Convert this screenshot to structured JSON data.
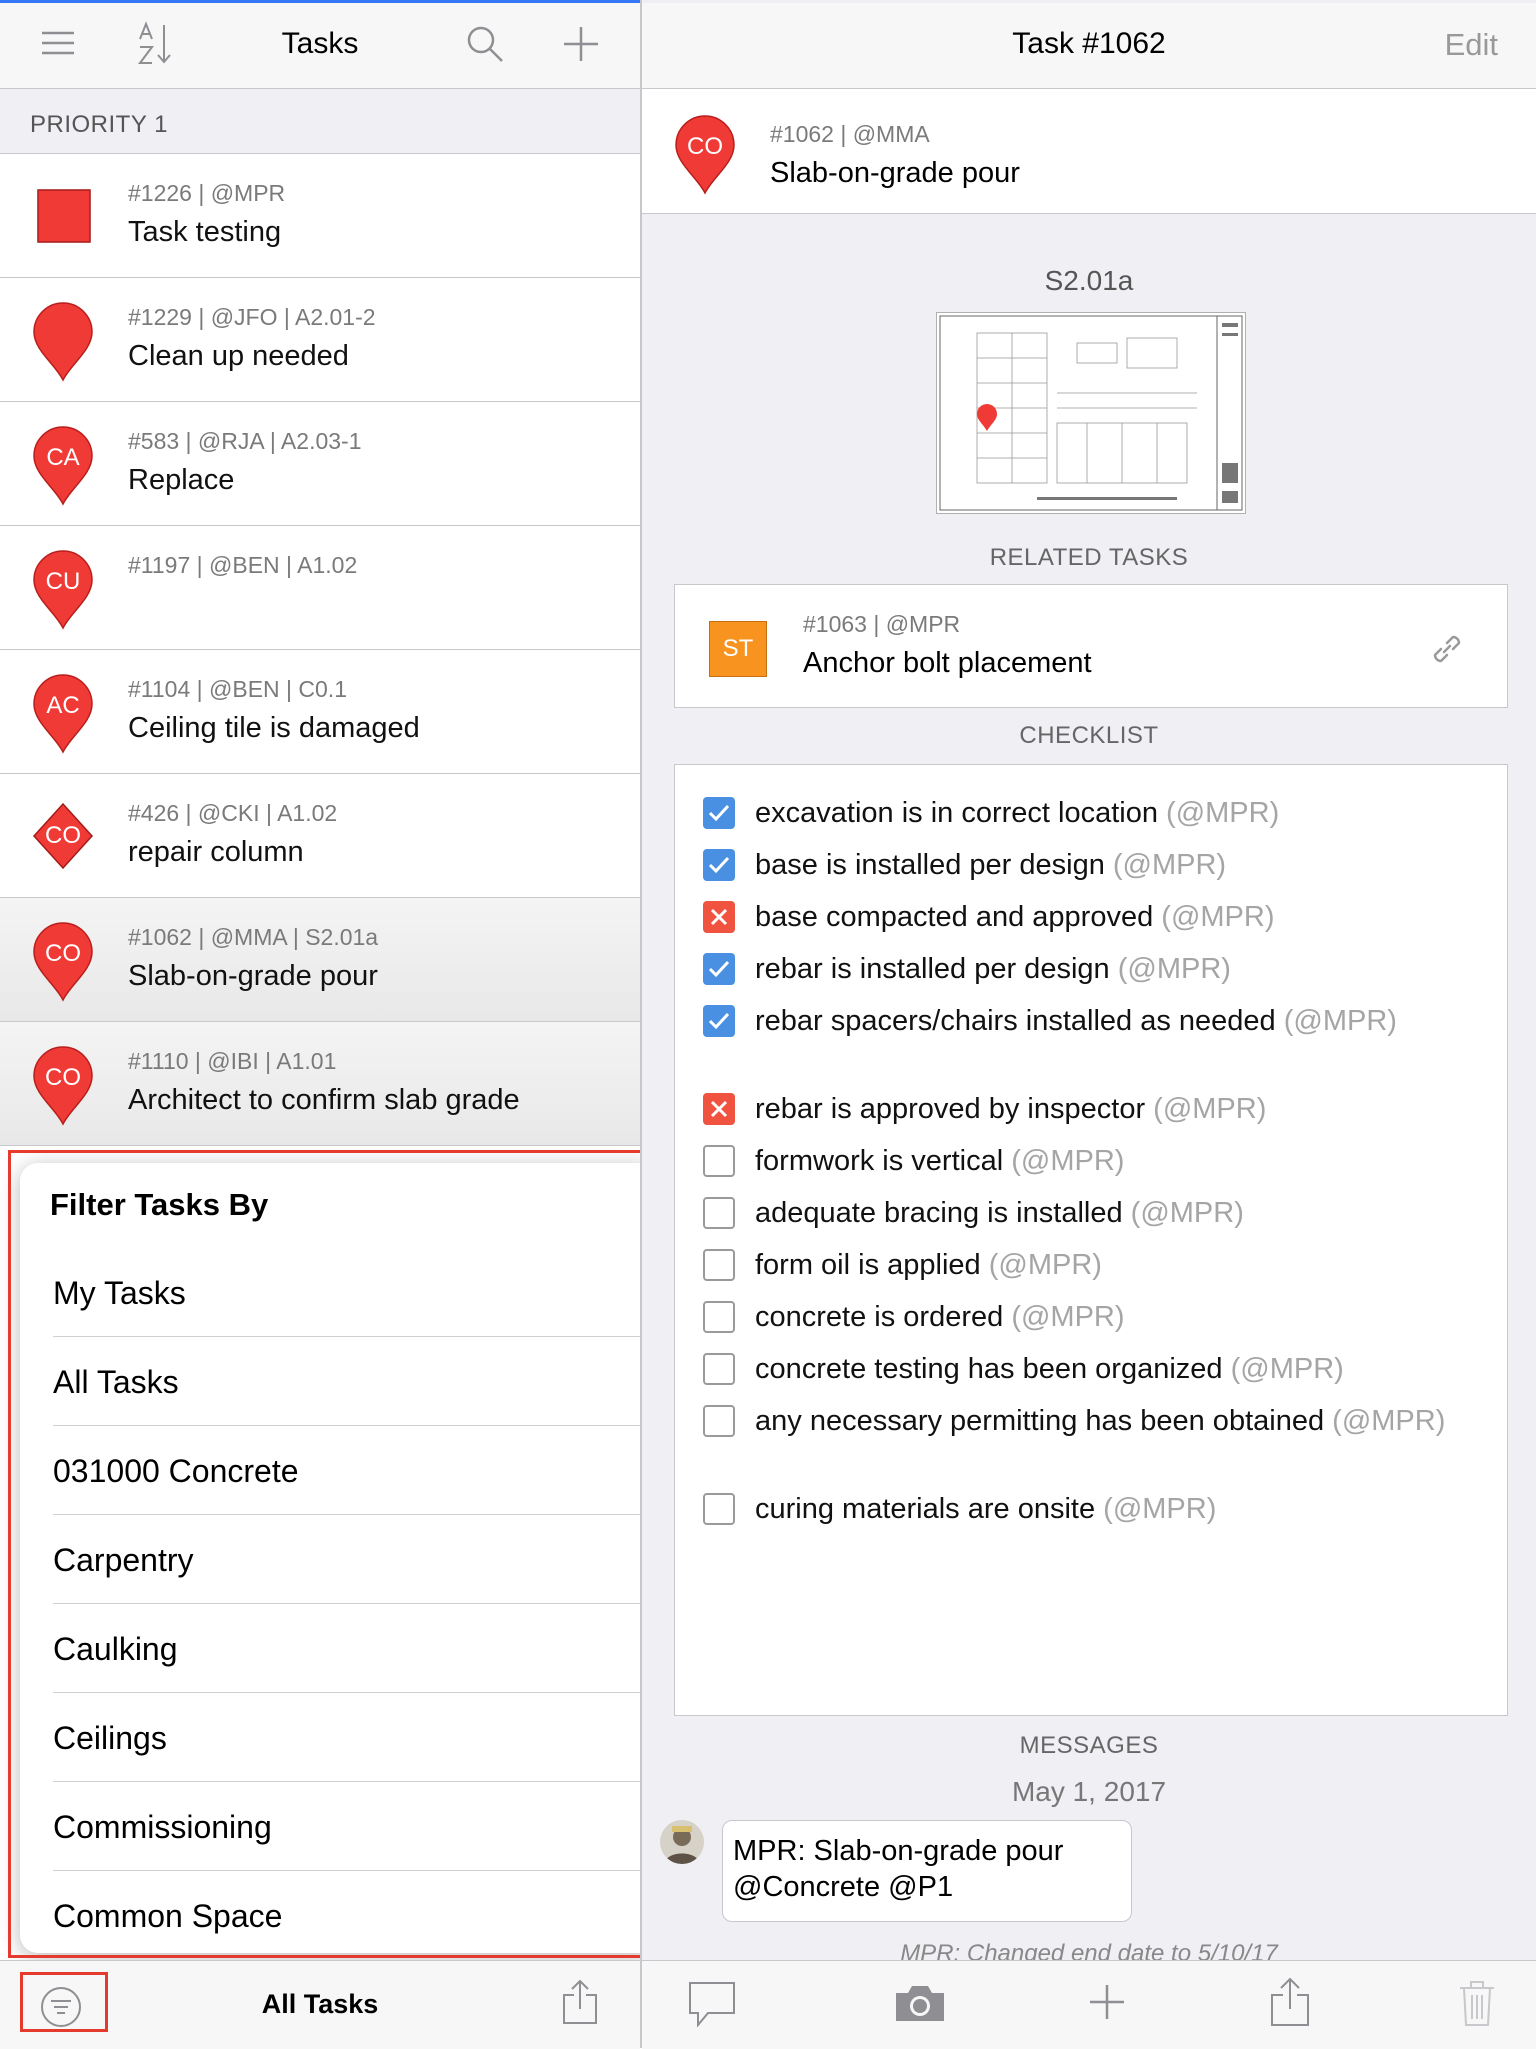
{
  "progress": {
    "value": 1.0,
    "color": "#3478f6"
  },
  "left_nav": {
    "title": "Tasks",
    "icons": [
      "menu-icon",
      "sort-az-icon",
      "search-icon",
      "add-icon"
    ]
  },
  "section": {
    "title": "PRIORITY 1"
  },
  "tasks": [
    {
      "meta": "#1226 | @MPR",
      "name": "Task testing",
      "marker": "square",
      "code": "",
      "color": "#f03a36"
    },
    {
      "meta": "#1229 | @JFO | A2.01-2",
      "name": "Clean up needed",
      "marker": "pin",
      "code": "",
      "color": "#f03a36"
    },
    {
      "meta": "#583 | @RJA | A2.03-1",
      "name": "Replace",
      "marker": "pin",
      "code": "CA",
      "color": "#f03a36"
    },
    {
      "meta": "#1197 | @BEN | A1.02",
      "name": "",
      "marker": "pin",
      "code": "CU",
      "color": "#f03a36"
    },
    {
      "meta": "#1104 | @BEN | C0.1",
      "name": "Ceiling tile is damaged",
      "marker": "pin",
      "code": "AC",
      "color": "#f03a36"
    },
    {
      "meta": "#426 | @CKI | A1.02",
      "name": "repair column",
      "marker": "diamond",
      "code": "CO",
      "color": "#f03a36"
    },
    {
      "meta": "#1062 | @MMA | S2.01a",
      "name": "Slab-on-grade pour",
      "marker": "pin",
      "code": "CO",
      "color": "#f03a36",
      "selected": true
    },
    {
      "meta": "#1110 | @IBI | A1.01",
      "name": "Architect to confirm slab grade",
      "marker": "pin",
      "code": "CO",
      "color": "#f03a36",
      "selected": true
    }
  ],
  "filter": {
    "title": "Filter Tasks By",
    "options": [
      "My Tasks",
      "All Tasks",
      "031000 Concrete",
      "Carpentry",
      "Caulking",
      "Ceilings",
      "Commissioning",
      "Common Space"
    ]
  },
  "left_toolbar": {
    "label": "All Tasks",
    "icons": [
      "filter-icon",
      "share-icon"
    ]
  },
  "right_nav": {
    "title": "Task #1062",
    "edit": "Edit"
  },
  "task_header": {
    "meta": "#1062 | @MMA",
    "name": "Slab-on-grade pour",
    "code": "CO",
    "color": "#f03a36"
  },
  "sheet": {
    "title": "S2.01a"
  },
  "related": {
    "caption": "RELATED TASKS",
    "meta": "#1063 | @MPR",
    "name": "Anchor bolt placement",
    "code": "ST",
    "color": "#f7931e"
  },
  "checklist": {
    "caption": "CHECKLIST",
    "items": [
      {
        "text": "excavation is in correct location",
        "who": "(@MPR)",
        "state": "checked"
      },
      {
        "text": "base is installed per design",
        "who": "(@MPR)",
        "state": "checked"
      },
      {
        "text": "base compacted and approved",
        "who": "(@MPR)",
        "state": "failed"
      },
      {
        "text": "rebar is installed per design",
        "who": "(@MPR)",
        "state": "checked"
      },
      {
        "text": "rebar spacers/chairs installed as needed",
        "who": "(@MPR)",
        "state": "checked"
      },
      {
        "text": "rebar is approved by inspector",
        "who": "(@MPR)",
        "state": "failed"
      },
      {
        "text": "formwork is vertical",
        "who": "(@MPR)",
        "state": "empty"
      },
      {
        "text": "adequate bracing is installed",
        "who": "(@MPR)",
        "state": "empty"
      },
      {
        "text": "form oil is applied",
        "who": "(@MPR)",
        "state": "empty"
      },
      {
        "text": "concrete is ordered",
        "who": "(@MPR)",
        "state": "empty"
      },
      {
        "text": "concrete testing has been organized",
        "who": "(@MPR)",
        "state": "empty"
      },
      {
        "text": "any necessary permitting has been obtained",
        "who": "(@MPR)",
        "state": "empty"
      },
      {
        "text": "curing materials are onsite",
        "who": "(@MPR)",
        "state": "empty"
      }
    ]
  },
  "messages": {
    "caption": "MESSAGES",
    "date": "May 1, 2017",
    "items": [
      {
        "text": "MPR: Slab-on-grade pour @Concrete @P1"
      }
    ],
    "system": "MPR: Changed end date to 5/10/17"
  },
  "right_toolbar": {
    "icons": [
      "comment-icon",
      "camera-icon",
      "add-icon",
      "share-icon",
      "trash-icon"
    ]
  }
}
